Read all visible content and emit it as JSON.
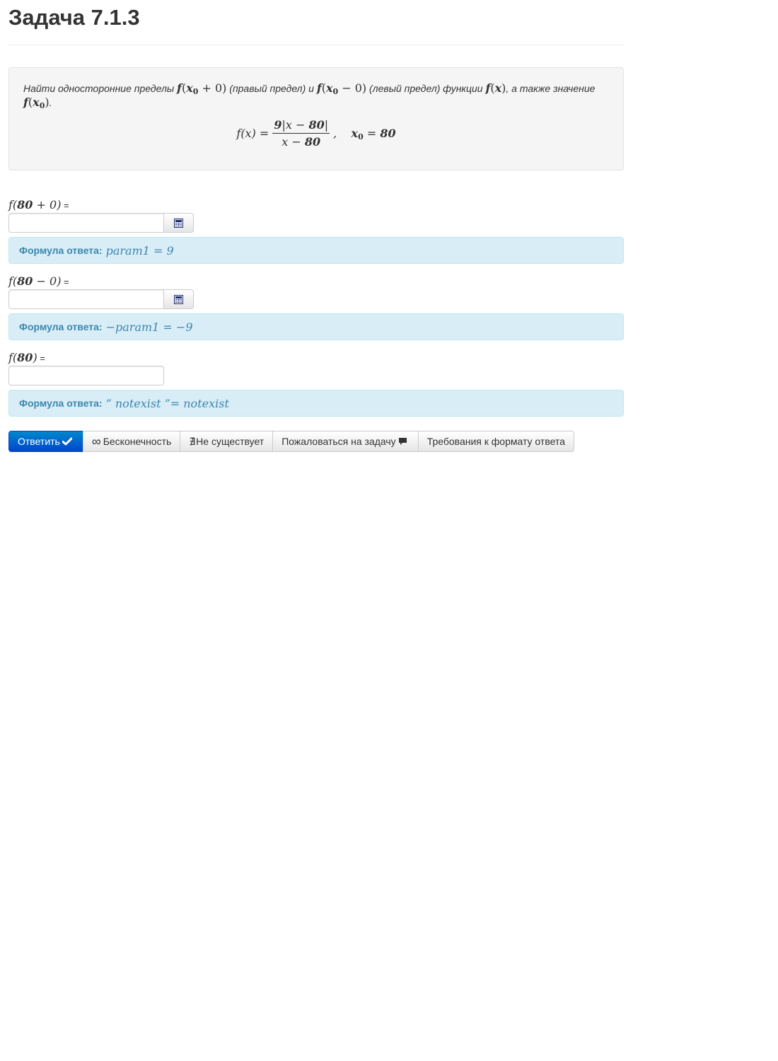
{
  "page": {
    "title": "Задача 7.1.3"
  },
  "problem": {
    "text_1": "Найти односторонние пределы ",
    "text_2": " (правый предел) и ",
    "text_3": " (левый предел) функции ",
    "text_4": ", а также значение",
    "text_5": "."
  },
  "fields": [
    {
      "label_suffix": " =",
      "input_value": "",
      "hint_label": "Формула ответа:"
    },
    {
      "label_suffix": " =",
      "input_value": "",
      "hint_label": "Формула ответа:"
    },
    {
      "label_suffix": " =",
      "input_value": "",
      "hint_label": "Формула ответа:"
    }
  ],
  "buttons": {
    "submit": "Ответить",
    "infinity": "Бесконечность",
    "not_exists": "Не существует",
    "report": "Пожаловаться на задачу",
    "requirements": "Требования к формату ответа"
  },
  "colors": {
    "primary": "#0055cc",
    "hint_bg": "#d9edf7",
    "hint_text": "#3a87ad",
    "well_bg": "#f5f5f5"
  },
  "icons": [
    "calculator-icon",
    "check-icon",
    "infinity-icon",
    "not-exists-icon",
    "speech-bubble-icon"
  ]
}
